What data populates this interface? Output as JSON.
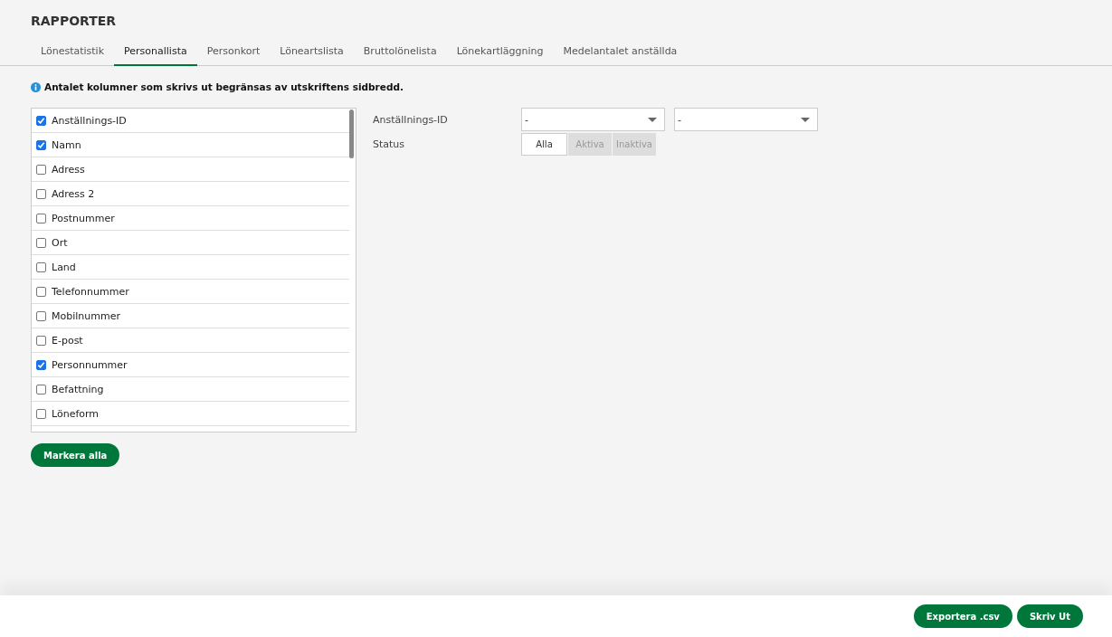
{
  "title": "RAPPORTER",
  "tabs": [
    {
      "label": "Lönestatistik",
      "selected": false
    },
    {
      "label": "Personallista",
      "selected": true
    },
    {
      "label": "Personkort",
      "selected": false
    },
    {
      "label": "Löneartslista",
      "selected": false
    },
    {
      "label": "Bruttolönelista",
      "selected": false
    },
    {
      "label": "Lönekartläggning",
      "selected": false
    },
    {
      "label": "Medelantalet anställda",
      "selected": false
    }
  ],
  "info": "Antalet kolumner som skrivs ut begränsas av utskriftens sidbredd.",
  "columns": [
    {
      "label": "Anställnings-ID",
      "checked": true
    },
    {
      "label": "Namn",
      "checked": true
    },
    {
      "label": "Adress",
      "checked": false
    },
    {
      "label": "Adress 2",
      "checked": false
    },
    {
      "label": "Postnummer",
      "checked": false
    },
    {
      "label": "Ort",
      "checked": false
    },
    {
      "label": "Land",
      "checked": false
    },
    {
      "label": "Telefonnummer",
      "checked": false
    },
    {
      "label": "Mobilnummer",
      "checked": false
    },
    {
      "label": "E-post",
      "checked": false
    },
    {
      "label": "Personnummer",
      "checked": true
    },
    {
      "label": "Befattning",
      "checked": false
    },
    {
      "label": "Löneform",
      "checked": false
    }
  ],
  "select_all_button": "Markera alla",
  "filters": {
    "id_label": "Anställnings-ID",
    "id_from": "-",
    "id_to": "-",
    "status_label": "Status",
    "status_options": [
      {
        "label": "Alla",
        "selected": true
      },
      {
        "label": "Aktiva",
        "selected": false
      },
      {
        "label": "Inaktiva",
        "selected": false
      }
    ]
  },
  "footer_buttons": [
    "Exportera .csv",
    "Skriv Ut"
  ]
}
